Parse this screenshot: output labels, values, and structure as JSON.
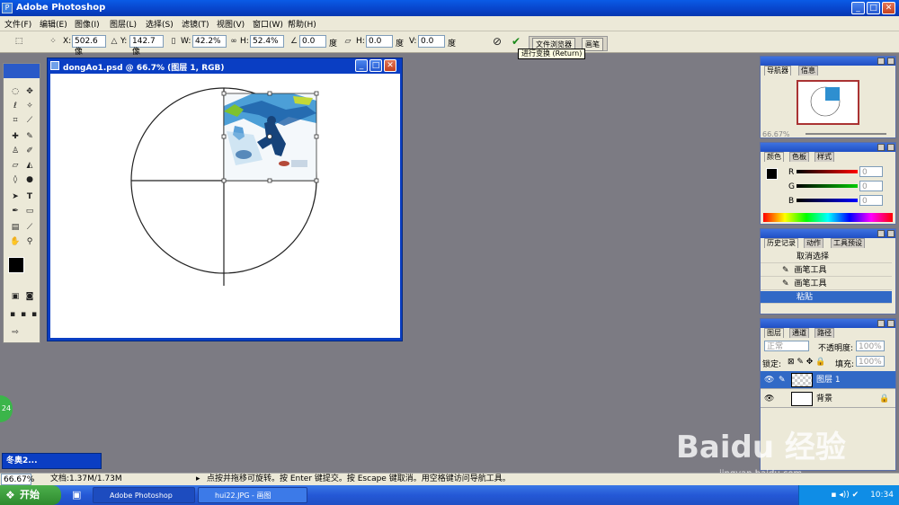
{
  "app": {
    "title": "Adobe Photoshop"
  },
  "menu": [
    "文件(F)",
    "编辑(E)",
    "图像(I)",
    "图层(L)",
    "选择(S)",
    "滤镜(T)",
    "视图(V)",
    "窗口(W)",
    "帮助(H)"
  ],
  "options": {
    "x_label": "X:",
    "x_value": "502.6 像",
    "y_label": "Y:",
    "y_value": "142.7 像",
    "w_label": "W:",
    "w_value": "42.2%",
    "h_label": "H:",
    "h_value": "52.4%",
    "angle_value": "0.0",
    "angle_unit": "度",
    "hskew_label": "H:",
    "hskew_value": "0.0",
    "hskew_unit": "度",
    "vskew_label": "V:",
    "vskew_value": "0.0",
    "vskew_unit": "度"
  },
  "tabwell": {
    "tab1": "文件浏览器",
    "tab2": "画笔"
  },
  "tooltip": "进行变换 (Return)",
  "document": {
    "title": "dongAo1.psd @ 66.7% (图层 1, RGB)"
  },
  "navigator": {
    "tab1": "导航器",
    "tab2": "信息",
    "zoom": "66.67%"
  },
  "color": {
    "tab1": "颜色",
    "tab2": "色板",
    "tab3": "样式",
    "r": "R",
    "g": "G",
    "b": "B",
    "r_val": "0",
    "g_val": "0",
    "b_val": "0"
  },
  "history": {
    "tab1": "历史记录",
    "tab2": "动作",
    "tab3": "工具预设",
    "items": [
      "取消选择",
      "画笔工具",
      "画笔工具",
      "粘贴"
    ]
  },
  "layers": {
    "tab1": "图层",
    "tab2": "通道",
    "tab3": "路径",
    "blend": "正常",
    "opacity_label": "不透明度:",
    "opacity": "100%",
    "lock_label": "锁定:",
    "fill_label": "填充:",
    "fill": "100%",
    "items": [
      "图层 1",
      "背景"
    ]
  },
  "minidoc": {
    "title": "冬奥2..."
  },
  "status": {
    "zoom": "66.67%",
    "doc": "文档:1.37M/1.73M",
    "message": "点按并拖移可旋转。按 Enter 键提交。按 Escape 键取消。用空格键访问导航工具。"
  },
  "taskbar": {
    "start": "开始",
    "task1": "Adobe Photoshop",
    "task2": "hui22.JPG - 画图",
    "time": "10:34"
  },
  "side_badge": "24",
  "watermark": {
    "main": "Baidu 经验",
    "sub": "jingyan.baidu.com"
  },
  "colors": {
    "xp_blue": "#0a5be6",
    "panel_bg": "#ece9d8",
    "selection": "#3169c6",
    "workspace": "#7c7b83"
  }
}
